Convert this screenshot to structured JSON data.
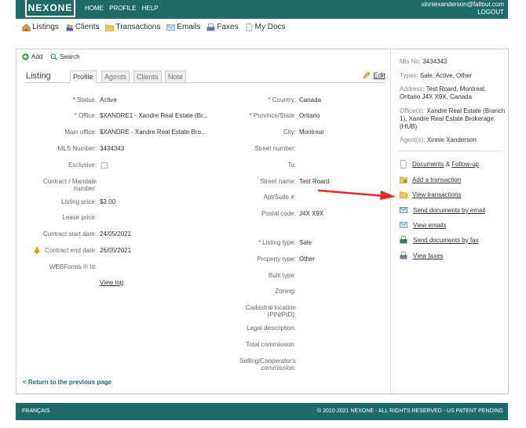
{
  "header": {
    "logo": "NEXONE",
    "nav": [
      "HOME",
      "PROFILE",
      "HELP"
    ],
    "user_email": "xinniexanderson@faltour.com",
    "logout": "LOGOUT"
  },
  "modules": [
    {
      "label": "Listings",
      "icon": "house-icon"
    },
    {
      "label": "Clients",
      "icon": "people-icon"
    },
    {
      "label": "Transactions",
      "icon": "folder-icon"
    },
    {
      "label": "Emails",
      "icon": "envelope-icon"
    },
    {
      "label": "Faxes",
      "icon": "fax-icon"
    },
    {
      "label": "My Docs",
      "icon": "document-icon"
    }
  ],
  "toolbar": {
    "add": "Add",
    "search": "Search"
  },
  "tabs": {
    "title": "Listing",
    "items": [
      "Profile",
      "Agents",
      "Clients",
      "Note"
    ],
    "edit": "Edit"
  },
  "left_fields": {
    "status": {
      "label": "* Status:",
      "value": "Active"
    },
    "office": {
      "label": "* Office:",
      "value": "$XANDRE1 - Xandre Real Estate (Br..."
    },
    "main_office": {
      "label": "Main office:",
      "value": "$XANDRE - Xandre Real Estate Bro..."
    },
    "mls": {
      "label": "MLS Number:",
      "value": "3434343"
    },
    "exclusive": {
      "label": "Exclusive:"
    },
    "contract": {
      "label1": "Contract / Mandate",
      "label2": "number:"
    },
    "listing_price": {
      "label": "Listing price:",
      "value": "$3.00"
    },
    "lease_price": {
      "label": "Lease price:"
    },
    "start_date": {
      "label": "Contract start date:",
      "value": "24/05/2021"
    },
    "end_date": {
      "label": "Contract end date:",
      "value": "26/05/2021"
    },
    "webforms": {
      "label": "WEBForms ® Id:"
    },
    "view_log": "View log"
  },
  "right_fields": {
    "country": {
      "label": "* Country:",
      "value": "Canada"
    },
    "province": {
      "label": "* Province/State:",
      "value": "Ontario"
    },
    "city": {
      "label": "City:",
      "value": "Montreal"
    },
    "street_number": {
      "label": "Street number:"
    },
    "to": {
      "label": "To:"
    },
    "street_name": {
      "label": "Street name:",
      "value": "Test Roard"
    },
    "apt": {
      "label": "Apt/Suite #:"
    },
    "postal": {
      "label": "Postal code:",
      "value": "J4X X9X"
    },
    "listing_type": {
      "label": "* Listing type:",
      "value": "Sale"
    },
    "property_type": {
      "label": "Property type:",
      "value": "Other"
    },
    "built_type": {
      "label": "Built type:"
    },
    "zoning": {
      "label": "Zoning:"
    },
    "cadastral": {
      "label1": "Cadastral location",
      "label2": "(PIN/PID):"
    },
    "legal": {
      "label": "Legal description:"
    },
    "commission": {
      "label": "Total commission:"
    },
    "selling": {
      "label1": "Selling/Cooperator's",
      "label2": "commission:"
    }
  },
  "back_link": "< Return to the previous page",
  "summary": {
    "mls": {
      "k": "Mls No:",
      "v": "3434343"
    },
    "types": {
      "k": "Types:",
      "v": "Sale, Active, Other"
    },
    "address": {
      "k": "Address:",
      "v": "Test Roard, Montreal, Ontario J4X X9X, Canada"
    },
    "offices": {
      "k": "Office(s):",
      "v": "Xandre Real Estate (Branch 1), Xandre Real Estate Brokerage (HUB)"
    },
    "agents": {
      "k": "Agent(s):",
      "v": "Xinnie Xanderson"
    }
  },
  "actions": {
    "documents": "Documents",
    "amp": "&",
    "followup": "Follow-up",
    "add_transaction": "Add a transaction",
    "view_transactions": "View transactions",
    "send_email": "Send documents by email",
    "view_emails": "View emails",
    "send_fax": "Send documents by fax",
    "view_faxes": "View faxes"
  },
  "footer": {
    "lang": "FRANÇAIS",
    "copyright": "© 2010-2021 NEXONE - ALL RIGHTS RESERVED - US PATENT PENDING"
  },
  "colors": {
    "brand": "#1f6b68",
    "arrow": "#e32b2b"
  }
}
